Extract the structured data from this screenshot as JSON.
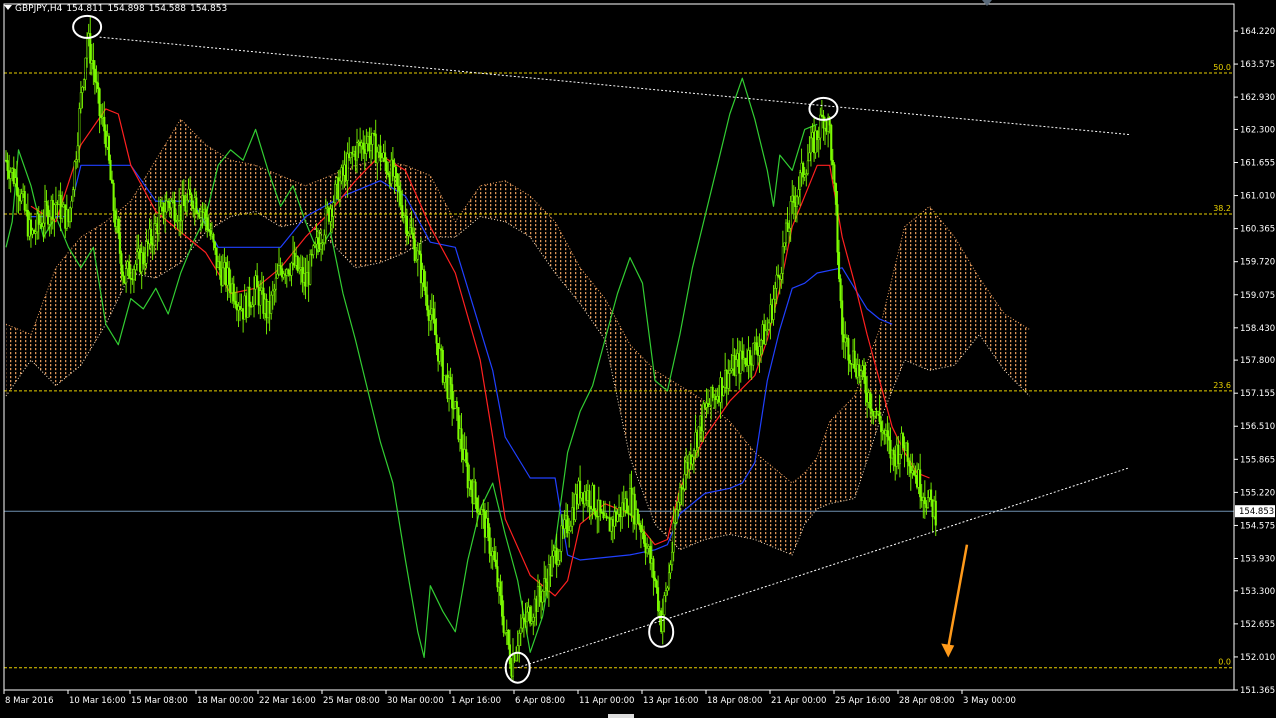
{
  "header": {
    "symbol": "GBPJPY,H4",
    "open": "154.811",
    "high": "154.898",
    "low": "154.588",
    "close": "154.853"
  },
  "colors": {
    "background": "#000000",
    "candles": "#7CFC00",
    "chikou": "#32CD32",
    "tenkan": "#FF2020",
    "kijun": "#2040FF",
    "cloud": "#F4A460",
    "fib_lines": "#E8D000",
    "price_line": "#6F8FAF",
    "trendlines": "#FFFFFF",
    "arrow": "#FF9A1A",
    "axis_text": "#FFFFFF"
  },
  "chart_data": {
    "type": "candlestick",
    "ylim": [
      151.365,
      164.6
    ],
    "y_ticks": [
      "164.220",
      "163.575",
      "162.930",
      "162.300",
      "161.655",
      "161.010",
      "160.365",
      "159.720",
      "159.075",
      "158.430",
      "157.800",
      "157.155",
      "156.510",
      "155.865",
      "155.220",
      "154.575",
      "153.930",
      "153.300",
      "152.655",
      "152.010",
      "151.365"
    ],
    "x_ticks": [
      "8 Mar 2016",
      "10 Mar 16:00",
      "15 Mar 08:00",
      "18 Mar 00:00",
      "22 Mar 16:00",
      "25 Mar 08:00",
      "30 Mar 00:00",
      "1 Apr 16:00",
      "6 Apr 08:00",
      "11 Apr 00:00",
      "13 Apr 16:00",
      "18 Apr 08:00",
      "21 Apr 00:00",
      "25 Apr 16:00",
      "28 Apr 08:00",
      "3 May 00:00"
    ],
    "current_price": "154.853",
    "current_price_value": 154.853,
    "fib_levels": [
      {
        "label": "50.0",
        "value": 163.4
      },
      {
        "label": "38.2",
        "value": 160.65
      },
      {
        "label": "23.6",
        "value": 157.2
      },
      {
        "label": "0.0",
        "value": 151.8
      }
    ],
    "close_path": [
      [
        0,
        161.7
      ],
      [
        2,
        161.2
      ],
      [
        4,
        160.2
      ],
      [
        6,
        160.6
      ],
      [
        8,
        160.9
      ],
      [
        10,
        160.5
      ],
      [
        11,
        161.6
      ],
      [
        12,
        162.9
      ],
      [
        13,
        164.1
      ],
      [
        14,
        163.5
      ],
      [
        15,
        162.6
      ],
      [
        16,
        162.2
      ],
      [
        17,
        161.0
      ],
      [
        18,
        160.1
      ],
      [
        19,
        159.4
      ],
      [
        20,
        159.6
      ],
      [
        22,
        159.8
      ],
      [
        24,
        160.4
      ],
      [
        26,
        160.9
      ],
      [
        28,
        160.7
      ],
      [
        30,
        161.0
      ],
      [
        32,
        160.6
      ],
      [
        34,
        159.6
      ],
      [
        36,
        159.3
      ],
      [
        38,
        158.8
      ],
      [
        40,
        159.2
      ],
      [
        42,
        158.7
      ],
      [
        44,
        159.6
      ],
      [
        46,
        159.7
      ],
      [
        48,
        159.3
      ],
      [
        50,
        160.1
      ],
      [
        52,
        160.8
      ],
      [
        54,
        161.4
      ],
      [
        56,
        161.9
      ],
      [
        58,
        162.1
      ],
      [
        60,
        161.8
      ],
      [
        62,
        161.4
      ],
      [
        64,
        160.6
      ],
      [
        66,
        159.8
      ],
      [
        68,
        158.7
      ],
      [
        70,
        157.6
      ],
      [
        72,
        156.8
      ],
      [
        74,
        155.5
      ],
      [
        76,
        154.9
      ],
      [
        78,
        154.0
      ],
      [
        80,
        152.5
      ],
      [
        81,
        151.9
      ],
      [
        82,
        152.4
      ],
      [
        84,
        152.9
      ],
      [
        86,
        153.3
      ],
      [
        88,
        154.0
      ],
      [
        90,
        154.6
      ],
      [
        92,
        155.3
      ],
      [
        94,
        155.1
      ],
      [
        96,
        154.5
      ],
      [
        98,
        154.8
      ],
      [
        100,
        155.1
      ],
      [
        102,
        154.5
      ],
      [
        104,
        153.5
      ],
      [
        105,
        152.7
      ],
      [
        106,
        153.4
      ],
      [
        108,
        155.3
      ],
      [
        110,
        156.1
      ],
      [
        112,
        156.8
      ],
      [
        114,
        157.2
      ],
      [
        116,
        157.6
      ],
      [
        118,
        157.8
      ],
      [
        120,
        158.0
      ],
      [
        122,
        158.4
      ],
      [
        124,
        159.6
      ],
      [
        126,
        160.8
      ],
      [
        128,
        161.6
      ],
      [
        130,
        162.2
      ],
      [
        131,
        162.6
      ],
      [
        132,
        162.3
      ],
      [
        133,
        160.6
      ],
      [
        134,
        158.3
      ],
      [
        136,
        157.8
      ],
      [
        138,
        157.2
      ],
      [
        140,
        156.6
      ],
      [
        142,
        155.9
      ],
      [
        144,
        156.2
      ],
      [
        146,
        155.5
      ],
      [
        148,
        155.0
      ],
      [
        149,
        154.85
      ]
    ],
    "tenkan": [
      [
        4,
        160.8
      ],
      [
        8,
        160.5
      ],
      [
        12,
        162.0
      ],
      [
        16,
        162.7
      ],
      [
        18,
        162.6
      ],
      [
        20,
        161.6
      ],
      [
        24,
        160.7
      ],
      [
        28,
        160.3
      ],
      [
        32,
        159.9
      ],
      [
        36,
        159.1
      ],
      [
        40,
        159.2
      ],
      [
        44,
        159.6
      ],
      [
        48,
        160.2
      ],
      [
        52,
        160.7
      ],
      [
        56,
        161.3
      ],
      [
        60,
        161.8
      ],
      [
        64,
        161.5
      ],
      [
        68,
        160.4
      ],
      [
        72,
        159.5
      ],
      [
        76,
        157.8
      ],
      [
        78,
        156.3
      ],
      [
        80,
        154.7
      ],
      [
        84,
        153.6
      ],
      [
        88,
        153.2
      ],
      [
        90,
        153.5
      ],
      [
        92,
        154.6
      ],
      [
        96,
        155.0
      ],
      [
        100,
        154.8
      ],
      [
        104,
        154.2
      ],
      [
        106,
        154.3
      ],
      [
        108,
        155.3
      ],
      [
        112,
        156.3
      ],
      [
        116,
        157.0
      ],
      [
        120,
        157.5
      ],
      [
        122,
        158.2
      ],
      [
        124,
        159.2
      ],
      [
        126,
        160.4
      ],
      [
        128,
        161.0
      ],
      [
        130,
        161.6
      ],
      [
        132,
        161.6
      ],
      [
        134,
        160.2
      ],
      [
        136,
        159.3
      ],
      [
        138,
        158.3
      ],
      [
        140,
        157.4
      ],
      [
        142,
        156.5
      ],
      [
        144,
        156.0
      ],
      [
        146,
        155.6
      ],
      [
        148,
        155.5
      ]
    ],
    "kijun": [
      [
        4,
        160.6
      ],
      [
        10,
        160.6
      ],
      [
        12,
        161.6
      ],
      [
        20,
        161.6
      ],
      [
        24,
        160.9
      ],
      [
        30,
        160.9
      ],
      [
        34,
        160.0
      ],
      [
        44,
        160.0
      ],
      [
        48,
        160.6
      ],
      [
        54,
        161.0
      ],
      [
        60,
        161.3
      ],
      [
        64,
        161.0
      ],
      [
        68,
        160.1
      ],
      [
        72,
        160.0
      ],
      [
        74,
        159.2
      ],
      [
        78,
        157.6
      ],
      [
        80,
        156.3
      ],
      [
        84,
        155.5
      ],
      [
        88,
        155.5
      ],
      [
        90,
        154.0
      ],
      [
        92,
        153.9
      ],
      [
        100,
        154.0
      ],
      [
        104,
        154.1
      ],
      [
        106,
        154.2
      ],
      [
        108,
        154.8
      ],
      [
        112,
        155.2
      ],
      [
        116,
        155.3
      ],
      [
        118,
        155.4
      ],
      [
        120,
        155.8
      ],
      [
        122,
        157.4
      ],
      [
        124,
        158.4
      ],
      [
        126,
        159.2
      ],
      [
        128,
        159.3
      ],
      [
        130,
        159.5
      ],
      [
        134,
        159.6
      ],
      [
        136,
        159.2
      ],
      [
        138,
        158.8
      ],
      [
        140,
        158.6
      ],
      [
        142,
        158.5
      ]
    ],
    "chikou": [
      [
        0,
        160.0
      ],
      [
        1,
        160.5
      ],
      [
        2,
        161.9
      ],
      [
        4,
        161.2
      ],
      [
        6,
        160.2
      ],
      [
        8,
        160.6
      ],
      [
        10,
        160.0
      ],
      [
        12,
        159.6
      ],
      [
        14,
        160.0
      ],
      [
        16,
        158.5
      ],
      [
        18,
        158.1
      ],
      [
        20,
        159.0
      ],
      [
        22,
        158.8
      ],
      [
        24,
        159.2
      ],
      [
        26,
        158.7
      ],
      [
        28,
        159.5
      ],
      [
        30,
        160.1
      ],
      [
        32,
        160.6
      ],
      [
        34,
        161.6
      ],
      [
        36,
        161.9
      ],
      [
        38,
        161.7
      ],
      [
        40,
        162.3
      ],
      [
        42,
        161.5
      ],
      [
        44,
        160.8
      ],
      [
        46,
        161.2
      ],
      [
        48,
        160.5
      ],
      [
        50,
        159.9
      ],
      [
        52,
        160.3
      ],
      [
        54,
        159.1
      ],
      [
        56,
        158.2
      ],
      [
        58,
        157.2
      ],
      [
        60,
        156.2
      ],
      [
        62,
        155.4
      ],
      [
        64,
        153.9
      ],
      [
        66,
        152.5
      ],
      [
        67,
        152.0
      ],
      [
        68,
        153.4
      ],
      [
        70,
        152.9
      ],
      [
        72,
        152.5
      ],
      [
        74,
        153.9
      ],
      [
        76,
        154.9
      ],
      [
        78,
        155.4
      ],
      [
        80,
        154.4
      ],
      [
        82,
        153.5
      ],
      [
        84,
        152.1
      ],
      [
        86,
        152.8
      ],
      [
        88,
        154.2
      ],
      [
        90,
        156.0
      ],
      [
        92,
        156.8
      ],
      [
        94,
        157.3
      ],
      [
        96,
        158.2
      ],
      [
        98,
        159.1
      ],
      [
        100,
        159.8
      ],
      [
        102,
        159.3
      ],
      [
        104,
        157.4
      ],
      [
        106,
        157.2
      ],
      [
        108,
        158.3
      ],
      [
        110,
        159.6
      ],
      [
        112,
        160.6
      ],
      [
        114,
        161.6
      ],
      [
        116,
        162.6
      ],
      [
        118,
        163.3
      ],
      [
        120,
        162.5
      ],
      [
        122,
        161.5
      ],
      [
        123,
        160.8
      ],
      [
        124,
        161.8
      ],
      [
        126,
        161.5
      ],
      [
        128,
        162.3
      ],
      [
        130,
        162.4
      ]
    ],
    "cloud": [
      [
        0,
        158.5,
        157.1
      ],
      [
        4,
        158.3,
        157.8
      ],
      [
        8,
        159.6,
        157.3
      ],
      [
        12,
        160.2,
        157.7
      ],
      [
        16,
        160.5,
        158.5
      ],
      [
        20,
        160.9,
        159.5
      ],
      [
        24,
        161.7,
        159.4
      ],
      [
        28,
        162.5,
        159.7
      ],
      [
        32,
        162.0,
        160.3
      ],
      [
        36,
        161.7,
        160.6
      ],
      [
        40,
        161.6,
        160.7
      ],
      [
        44,
        161.4,
        160.4
      ],
      [
        48,
        161.2,
        160.5
      ],
      [
        52,
        161.4,
        160.1
      ],
      [
        56,
        161.6,
        159.6
      ],
      [
        60,
        161.7,
        159.7
      ],
      [
        64,
        161.6,
        159.9
      ],
      [
        68,
        161.4,
        160.2
      ],
      [
        72,
        160.5,
        160.2
      ],
      [
        76,
        161.2,
        160.6
      ],
      [
        80,
        161.3,
        160.5
      ],
      [
        84,
        161.0,
        160.2
      ],
      [
        88,
        160.5,
        159.5
      ],
      [
        92,
        159.6,
        158.9
      ],
      [
        96,
        159.0,
        158.2
      ],
      [
        100,
        158.1,
        155.9
      ],
      [
        104,
        157.6,
        154.6
      ],
      [
        108,
        157.3,
        154.1
      ],
      [
        112,
        157.0,
        154.3
      ],
      [
        116,
        156.6,
        154.4
      ],
      [
        120,
        156.0,
        154.3
      ],
      [
        124,
        155.6,
        154.1
      ],
      [
        126,
        155.4,
        154.0
      ],
      [
        128,
        155.6,
        154.6
      ],
      [
        130,
        155.9,
        154.9
      ],
      [
        132,
        156.6,
        155.0
      ],
      [
        136,
        157.1,
        155.1
      ],
      [
        140,
        158.4,
        156.6
      ],
      [
        144,
        160.4,
        157.8
      ],
      [
        148,
        160.8,
        157.6
      ],
      [
        152,
        160.2,
        157.7
      ],
      [
        156,
        159.4,
        158.3
      ],
      [
        160,
        158.7,
        157.6
      ],
      [
        164,
        158.4,
        157.1
      ]
    ],
    "trendlines": [
      {
        "name": "upper",
        "from": [
          15,
          164.1
        ],
        "to": [
          180,
          162.2
        ]
      },
      {
        "name": "lower",
        "from": [
          82,
          151.8
        ],
        "to": [
          180,
          155.7
        ]
      }
    ],
    "circled_points": [
      [
        13,
        164.3
      ],
      [
        131,
        162.7
      ],
      [
        82,
        151.8
      ],
      [
        105,
        152.5
      ]
    ],
    "arrow": {
      "from": [
        154,
        154.2
      ],
      "to": [
        151,
        152.0
      ]
    }
  }
}
